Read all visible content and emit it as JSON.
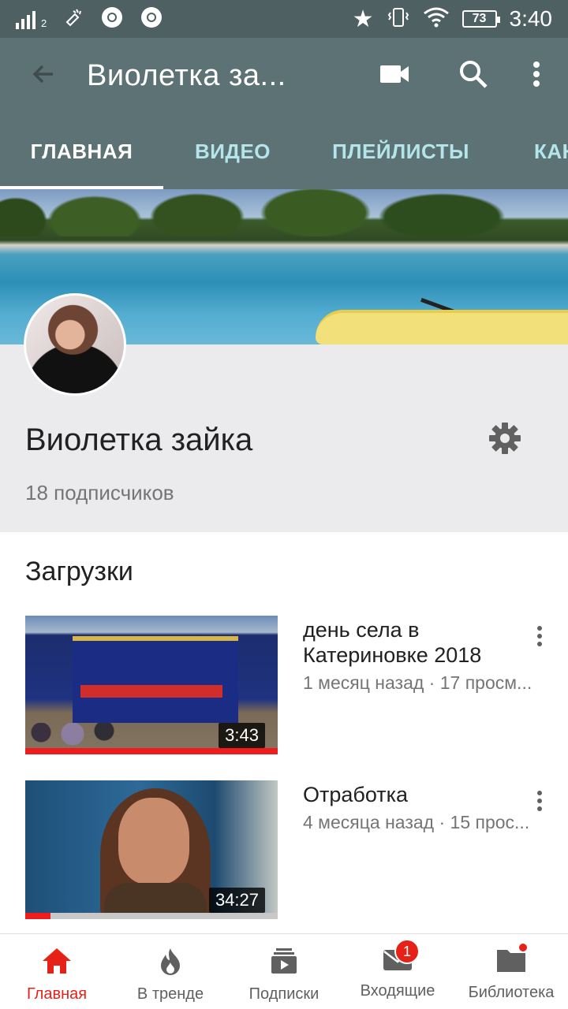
{
  "status_bar": {
    "signal_sub": "2",
    "battery": "73",
    "time": "3:40"
  },
  "app_bar": {
    "title": "Виолетка за...",
    "icons": [
      "back-arrow-icon",
      "video-camera-icon",
      "search-icon",
      "more-vert-icon"
    ]
  },
  "tabs": [
    {
      "label": "ГЛАВНАЯ",
      "active": true
    },
    {
      "label": "ВИДЕО",
      "active": false
    },
    {
      "label": "ПЛЕЙЛИСТЫ",
      "active": false
    },
    {
      "label": "КАН",
      "active": false
    }
  ],
  "channel": {
    "name": "Виолетка зайка",
    "subscribers": "18 подписчиков"
  },
  "uploads": {
    "title": "Загрузки",
    "videos": [
      {
        "title": "день села в Катериновке 2018",
        "meta": "1 месяц назад · 17 просм...",
        "duration": "3:43",
        "watched_fraction": 1.0
      },
      {
        "title": "Отработка",
        "meta": "4 месяца назад · 15 прос...",
        "duration": "34:27",
        "watched_fraction": 0.1
      }
    ]
  },
  "bottom_nav": [
    {
      "label": "Главная",
      "icon": "home-icon",
      "active": true
    },
    {
      "label": "В тренде",
      "icon": "flame-icon",
      "active": false
    },
    {
      "label": "Подписки",
      "icon": "subscriptions-icon",
      "active": false,
      "dot": true
    },
    {
      "label": "Входящие",
      "icon": "inbox-mail-icon",
      "active": false,
      "badge": "1"
    },
    {
      "label": "Библиотека",
      "icon": "folder-icon",
      "active": false
    }
  ],
  "colors": {
    "status_bar": "#4e6062",
    "app_bar": "#5c7274",
    "tab_inactive": "#b4e5ea",
    "accent_red": "#e62117"
  }
}
